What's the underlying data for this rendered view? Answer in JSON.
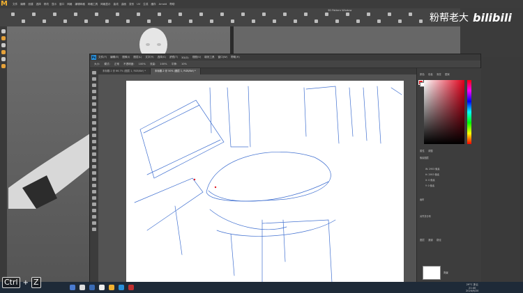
{
  "maya": {
    "menu": [
      "文件",
      "编辑",
      "创建",
      "选择",
      "修改",
      "显示",
      "窗口",
      "网格",
      "编辑网格",
      "网格工具",
      "网格显示",
      "曲线",
      "曲面",
      "变形",
      "UV",
      "生成",
      "缓存",
      "Arnold",
      "帮助"
    ],
    "window_title": "3D Pattern Window"
  },
  "watermark": {
    "text": "粉帮老大",
    "brand": "bilibili"
  },
  "photoshop": {
    "logo": "Ps",
    "menu": [
      "文件(F)",
      "编辑(E)",
      "图像(I)",
      "图层(L)",
      "文字(Y)",
      "选择(S)",
      "滤镜(T)",
      "3D(D)",
      "视图(V)",
      "增效工具",
      "窗口(W)",
      "帮助(H)"
    ],
    "options": [
      "大小:",
      "模式:",
      "正常",
      "不透明度:",
      "100%",
      "流量:",
      "100%",
      "平滑:",
      "10%"
    ],
    "tabs": [
      {
        "label": "未标题-1 @ 66.7% (图层 1, RGB/8#) *",
        "active": false
      },
      {
        "label": "未标题-2 @ 50% (图层 1, RGB/8#) *",
        "active": true
      }
    ],
    "panel": {
      "color_tab": "颜色",
      "swatches_tab": "色板",
      "gradient_tab": "渐变",
      "pattern_tab": "图案",
      "properties_tab": "属性",
      "adjustments_tab": "调整",
      "props_rows": [
        "像素图层",
        "W: 2953 像素",
        "H: 2953 像素",
        "X: 0 像素",
        "Y: 0 像素",
        "画布",
        "对齐并分布"
      ],
      "layers_tab": "图层",
      "channels_tab": "通道",
      "paths_tab": "路径",
      "layer_name": "背景"
    }
  },
  "taskbar": {
    "time": "21:40",
    "date": "2024/6/20",
    "weather": "29°C 多云"
  },
  "key_overlay": {
    "key1": "Ctrl",
    "plus": "+",
    "key2": "Z"
  },
  "colors": {
    "accent_red": "#e11b22",
    "sketch_blue": "#3f6fd0",
    "ps_blue": "#2a8fd8",
    "maya_logo": "#f0b030"
  }
}
